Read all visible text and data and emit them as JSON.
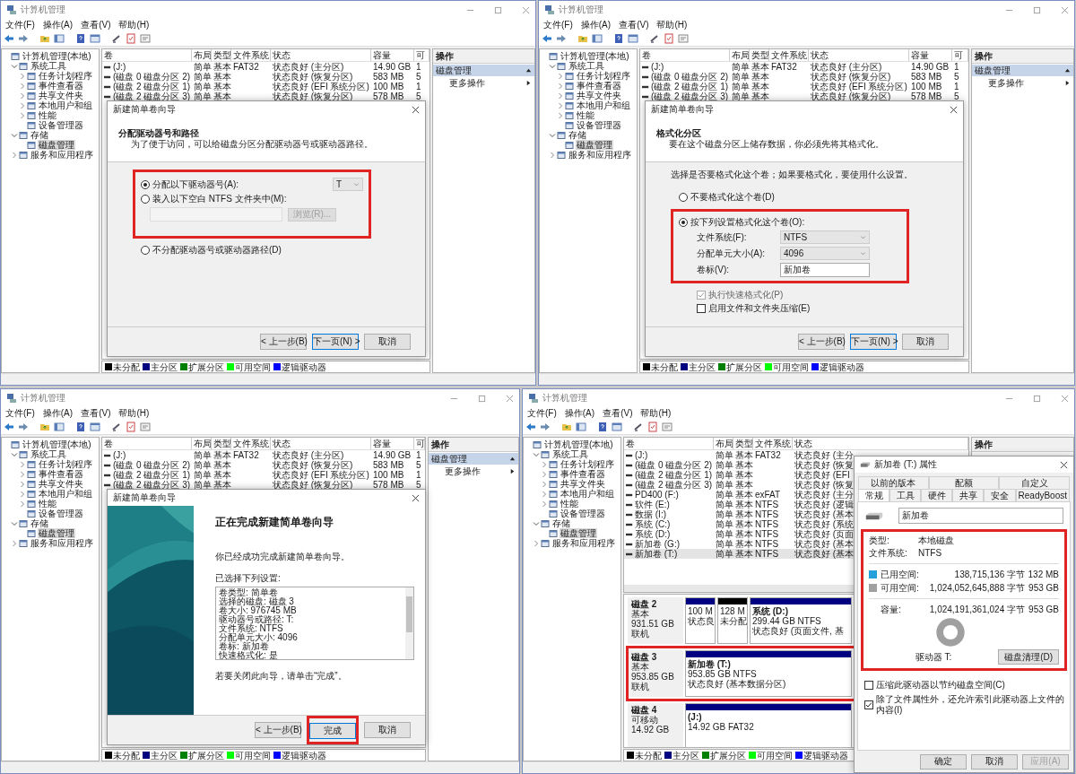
{
  "windows": [
    {
      "title": "计算机管理",
      "menu": [
        "文件(F)",
        "操作(A)",
        "查看(V)",
        "帮助(H)"
      ],
      "tree": [
        {
          "label": "计算机管理(本地)",
          "selected": false,
          "children": [
            {
              "label": "系统工具",
              "selected": false,
              "expanded": true,
              "children": [
                {
                  "label": "任务计划程序",
                  "selected": false,
                  "expanded": false
                },
                {
                  "label": "事件查看器",
                  "selected": false,
                  "expanded": false
                },
                {
                  "label": "共享文件夹",
                  "selected": false,
                  "expanded": false
                },
                {
                  "label": "本地用户和组",
                  "selected": false,
                  "expanded": false
                },
                {
                  "label": "性能",
                  "selected": false,
                  "expanded": false
                },
                {
                  "label": "设备管理器",
                  "selected": false
                }
              ]
            },
            {
              "label": "存储",
              "selected": false,
              "expanded": true,
              "children": [
                {
                  "label": "磁盘管理",
                  "selected": true
                }
              ]
            },
            {
              "label": "服务和应用程序",
              "selected": false,
              "expanded": false
            }
          ]
        }
      ],
      "columns": [
        "卷",
        "布局",
        "类型",
        "文件系统",
        "状态",
        "容量",
        "可"
      ],
      "rows": [
        {
          "volume": "(J:)",
          "layout": "简单",
          "type": "基本",
          "file_system": "FAT32",
          "status": "状态良好 (主分区)",
          "capacity": "14.90 GB",
          "column_7": "1",
          "selected": false
        },
        {
          "volume": "(磁盘 0 磁盘分区 2)",
          "layout": "简单",
          "type": "基本",
          "status": "状态良好 (恢复分区)",
          "capacity": "583 MB",
          "column_7": "5",
          "selected": false
        },
        {
          "volume": "(磁盘 2 磁盘分区 1)",
          "layout": "简单",
          "type": "基本",
          "status": "状态良好 (EFI 系统分区)",
          "capacity": "100 MB",
          "column_7": "1",
          "selected": false
        },
        {
          "volume": "(磁盘 2 磁盘分区 3)",
          "layout": "简单",
          "type": "基本",
          "status": "状态良好 (恢复分区)",
          "capacity": "578 MB",
          "column_7": "5",
          "selected": false
        }
      ],
      "legend": [
        {
          "label": "未分配",
          "color": "#000000"
        },
        {
          "label": "主分区",
          "color": "#000080"
        },
        {
          "label": "扩展分区",
          "color": "#008000"
        },
        {
          "label": "可用空间",
          "color": "#00ff00"
        },
        {
          "label": "逻辑驱动器",
          "color": "#0000ff"
        }
      ],
      "actions": {
        "title": "操作",
        "group": "磁盘管理",
        "items": [
          "更多操作"
        ]
      },
      "dialog": {
        "kind": "wizard",
        "title": "新建简单卷向导",
        "heading": "分配驱动器号和路径",
        "subheading": "为了便于访问，可以给磁盘分区分配驱动器号或驱动器路径。",
        "sections": [
          {
            "highlighted": true,
            "items": [
              {
                "kind": "radio",
                "label": "分配以下驱动器号(A):",
                "selected": true,
                "value": "T"
              },
              {
                "kind": "radio",
                "label": "装入以下空白 NTFS 文件夹中(M):",
                "selected": false
              },
              {
                "kind": "folder_path",
                "button": "浏览(R)...",
                "disabled": true
              }
            ]
          },
          {
            "items": [
              {
                "kind": "radio",
                "label": "不分配驱动器号或驱动器路径(D)",
                "selected": false
              }
            ]
          }
        ],
        "buttons": [
          {
            "label": "< 上一步(B)",
            "default": false
          },
          {
            "label": "下一页(N) >",
            "default": true
          },
          {
            "label": "取消",
            "default": false
          }
        ]
      }
    },
    {
      "title": "计算机管理",
      "menu": [
        "文件(F)",
        "操作(A)",
        "查看(V)",
        "帮助(H)"
      ],
      "tree": [
        {
          "label": "计算机管理(本地)",
          "selected": false,
          "children": [
            {
              "label": "系统工具",
              "selected": false,
              "expanded": true,
              "children": [
                {
                  "label": "任务计划程序",
                  "selected": false,
                  "expanded": false
                },
                {
                  "label": "事件查看器",
                  "selected": false,
                  "expanded": false
                },
                {
                  "label": "共享文件夹",
                  "selected": false,
                  "expanded": false
                },
                {
                  "label": "本地用户和组",
                  "selected": false,
                  "expanded": false
                },
                {
                  "label": "性能",
                  "selected": false,
                  "expanded": false
                },
                {
                  "label": "设备管理器",
                  "selected": false
                }
              ]
            },
            {
              "label": "存储",
              "selected": false,
              "expanded": true,
              "children": [
                {
                  "label": "磁盘管理",
                  "selected": true
                }
              ]
            },
            {
              "label": "服务和应用程序",
              "selected": false,
              "expanded": false
            }
          ]
        }
      ],
      "columns": [
        "卷",
        "布局",
        "类型",
        "文件系统",
        "状态",
        "容量",
        "可"
      ],
      "rows": [
        {
          "volume": "(J:)",
          "layout": "简单",
          "type": "基本",
          "file_system": "FAT32",
          "status": "状态良好 (主分区)",
          "capacity": "14.90 GB",
          "column_7": "1",
          "selected": false
        },
        {
          "volume": "(磁盘 0 磁盘分区 2)",
          "layout": "简单",
          "type": "基本",
          "status": "状态良好 (恢复分区)",
          "capacity": "583 MB",
          "column_7": "5",
          "selected": false
        },
        {
          "volume": "(磁盘 2 磁盘分区 1)",
          "layout": "简单",
          "type": "基本",
          "status": "状态良好 (EFI 系统分区)",
          "capacity": "100 MB",
          "column_7": "1",
          "selected": false
        },
        {
          "volume": "(磁盘 2 磁盘分区 3)",
          "layout": "简单",
          "type": "基本",
          "status": "状态良好 (恢复分区)",
          "capacity": "578 MB",
          "column_7": "5",
          "selected": false
        }
      ],
      "legend": [
        {
          "label": "未分配",
          "color": "#000000"
        },
        {
          "label": "主分区",
          "color": "#000080"
        },
        {
          "label": "扩展分区",
          "color": "#008000"
        },
        {
          "label": "可用空间",
          "color": "#00ff00"
        },
        {
          "label": "逻辑驱动器",
          "color": "#0000ff"
        }
      ],
      "actions": {
        "title": "操作",
        "group": "磁盘管理",
        "items": [
          "更多操作"
        ]
      },
      "dialog": {
        "kind": "wizard",
        "title": "新建简单卷向导",
        "heading": "格式化分区",
        "subheading": "要在这个磁盘分区上储存数据，你必须先将其格式化。",
        "intro": "选择是否要格式化这个卷；如果要格式化，要使用什么设置。",
        "sections": [
          {
            "items": [
              {
                "kind": "radio",
                "label": "不要格式化这个卷(D)",
                "selected": false
              }
            ]
          },
          {
            "highlighted": true,
            "items": [
              {
                "kind": "radio",
                "label": "按下列设置格式化这个卷(O):",
                "selected": true
              },
              {
                "kind": "dropdown",
                "label": "文件系统(F):",
                "value": "NTFS"
              },
              {
                "kind": "dropdown",
                "label": "分配单元大小(A):",
                "value": "4096"
              },
              {
                "kind": "text",
                "label": "卷标(V):",
                "value": "新加卷"
              }
            ]
          },
          {
            "items": [
              {
                "kind": "checkbox",
                "label": "执行快速格式化(P)",
                "checked": true,
                "disabled": true
              },
              {
                "kind": "checkbox",
                "label": "启用文件和文件夹压缩(E)",
                "checked": false,
                "disabled": false
              }
            ]
          }
        ],
        "buttons": [
          {
            "label": "< 上一步(B)",
            "default": false
          },
          {
            "label": "下一页(N) >",
            "default": true
          },
          {
            "label": "取消",
            "default": false
          }
        ]
      }
    },
    {
      "title": "计算机管理",
      "menu": [
        "文件(F)",
        "操作(A)",
        "查看(V)",
        "帮助(H)"
      ],
      "tree": [
        {
          "label": "计算机管理(本地)",
          "selected": false,
          "children": [
            {
              "label": "系统工具",
              "selected": false,
              "expanded": true,
              "children": [
                {
                  "label": "任务计划程序",
                  "selected": false,
                  "expanded": false
                },
                {
                  "label": "事件查看器",
                  "selected": false,
                  "expanded": false
                },
                {
                  "label": "共享文件夹",
                  "selected": false,
                  "expanded": false
                },
                {
                  "label": "本地用户和组",
                  "selected": false,
                  "expanded": false
                },
                {
                  "label": "性能",
                  "selected": false,
                  "expanded": false
                },
                {
                  "label": "设备管理器",
                  "selected": false
                }
              ]
            },
            {
              "label": "存储",
              "selected": false,
              "expanded": true,
              "children": [
                {
                  "label": "磁盘管理",
                  "selected": true
                }
              ]
            },
            {
              "label": "服务和应用程序",
              "selected": false,
              "expanded": false
            }
          ]
        }
      ],
      "columns": [
        "卷",
        "布局",
        "类型",
        "文件系统",
        "状态",
        "容量",
        "可"
      ],
      "rows": [
        {
          "volume": "(J:)",
          "layout": "简单",
          "type": "基本",
          "file_system": "FAT32",
          "status": "状态良好 (主分区)",
          "capacity": "14.90 GB",
          "column_7": "1",
          "selected": false
        },
        {
          "volume": "(磁盘 0 磁盘分区 2)",
          "layout": "简单",
          "type": "基本",
          "status": "状态良好 (恢复分区)",
          "capacity": "583 MB",
          "column_7": "5",
          "selected": false
        },
        {
          "volume": "(磁盘 2 磁盘分区 1)",
          "layout": "简单",
          "type": "基本",
          "status": "状态良好 (EFI 系统分区)",
          "capacity": "100 MB",
          "column_7": "1",
          "selected": false
        },
        {
          "volume": "(磁盘 2 磁盘分区 3)",
          "layout": "简单",
          "type": "基本",
          "status": "状态良好 (恢复分区)",
          "capacity": "578 MB",
          "column_7": "5",
          "selected": false
        }
      ],
      "legend": [
        {
          "label": "未分配",
          "color": "#000000"
        },
        {
          "label": "主分区",
          "color": "#000080"
        },
        {
          "label": "扩展分区",
          "color": "#008000"
        },
        {
          "label": "可用空间",
          "color": "#00ff00"
        },
        {
          "label": "逻辑驱动器",
          "color": "#0000ff"
        }
      ],
      "actions": {
        "title": "操作",
        "group": "磁盘管理",
        "items": [
          "更多操作"
        ]
      },
      "dialog": {
        "kind": "finish",
        "title": "新建简单卷向导",
        "heading": "正在完成新建简单卷向导",
        "message": "你已经成功完成新建简单卷向导。",
        "settings_label": "已选择下列设置:",
        "settings": [
          "卷类型: 简单卷",
          "选择的磁盘: 磁盘 3",
          "卷大小: 976745 MB",
          "驱动器号或路径: T:",
          "文件系统: NTFS",
          "分配单元大小: 4096",
          "卷标: 新加卷",
          "快速格式化: 是"
        ],
        "closing": "若要关闭此向导，请单击“完成”。",
        "buttons": [
          {
            "label": "< 上一步(B)",
            "default": false
          },
          {
            "label": "完成",
            "default": true,
            "highlighted": true
          },
          {
            "label": "取消",
            "default": false
          }
        ]
      }
    },
    {
      "title": "计算机管理",
      "menu": [
        "文件(F)",
        "操作(A)",
        "查看(V)",
        "帮助(H)"
      ],
      "tree": [
        {
          "label": "计算机管理(本地)",
          "selected": false,
          "children": [
            {
              "label": "系统工具",
              "selected": false,
              "expanded": true,
              "children": [
                {
                  "label": "任务计划程序",
                  "selected": false,
                  "expanded": false
                },
                {
                  "label": "事件查看器",
                  "selected": false,
                  "expanded": false
                },
                {
                  "label": "共享文件夹",
                  "selected": false,
                  "expanded": false
                },
                {
                  "label": "本地用户和组",
                  "selected": false,
                  "expanded": false
                },
                {
                  "label": "性能",
                  "selected": false,
                  "expanded": false
                },
                {
                  "label": "设备管理器",
                  "selected": false
                }
              ]
            },
            {
              "label": "存储",
              "selected": false,
              "expanded": true,
              "children": [
                {
                  "label": "磁盘管理",
                  "selected": true
                }
              ]
            },
            {
              "label": "服务和应用程序",
              "selected": false,
              "expanded": false
            }
          ]
        }
      ],
      "columns": [
        "卷",
        "布局",
        "类型",
        "文件系统",
        "状态"
      ],
      "rows": [
        {
          "volume": "(J:)",
          "layout": "简单",
          "type": "基本",
          "file_system": "FAT32",
          "status": "状态良好 (主分",
          "selected": false
        },
        {
          "volume": "(磁盘 0 磁盘分区 2)",
          "layout": "简单",
          "type": "基本",
          "status": "状态良好 (恢复",
          "selected": false
        },
        {
          "volume": "(磁盘 2 磁盘分区 1)",
          "layout": "简单",
          "type": "基本",
          "status": "状态良好 (EFI",
          "selected": false
        },
        {
          "volume": "(磁盘 2 磁盘分区 3)",
          "layout": "简单",
          "type": "基本",
          "status": "状态良好 (恢复",
          "selected": false
        },
        {
          "volume": "PD400 (F:)",
          "layout": "简单",
          "type": "基本",
          "file_system": "exFAT",
          "status": "状态良好 (主分",
          "selected": false
        },
        {
          "volume": "软件 (E:)",
          "layout": "简单",
          "type": "基本",
          "file_system": "NTFS",
          "status": "状态良好 (逻辑",
          "selected": false
        },
        {
          "volume": "数据 (I:)",
          "layout": "简单",
          "type": "基本",
          "file_system": "NTFS",
          "status": "状态良好 (基本",
          "selected": false
        },
        {
          "volume": "系统 (C:)",
          "layout": "简单",
          "type": "基本",
          "file_system": "NTFS",
          "status": "状态良好 (系统,",
          "selected": false
        },
        {
          "volume": "系统 (D:)",
          "layout": "简单",
          "type": "基本",
          "file_system": "NTFS",
          "status": "状态良好 (页面",
          "selected": false
        },
        {
          "volume": "新加卷 (G:)",
          "layout": "简单",
          "type": "基本",
          "file_system": "NTFS",
          "status": "状态良好 (基本",
          "selected": false
        },
        {
          "volume": "新加卷 (T:)",
          "layout": "简单",
          "type": "基本",
          "file_system": "NTFS",
          "status": "状态良好 (基本",
          "selected": true
        }
      ],
      "disks": [
        {
          "name": "磁盘 2",
          "type": "基本",
          "size": "931.51 GB",
          "state": "联机",
          "partitions": [
            {
              "lines": [
                "100 M",
                "状态良"
              ],
              "color": "#000080"
            },
            {
              "lines": [
                "128 M",
                "未分配"
              ],
              "color": "#000000"
            },
            {
              "title": "系统 (D:)",
              "lines": [
                "299.44 GB NTFS",
                "状态良好 (页面文件, 基"
              ],
              "color": "#000080"
            }
          ]
        },
        {
          "name": "磁盘 3",
          "type": "基本",
          "size": "953.85 GB",
          "state": "联机",
          "highlighted": true,
          "partitions": [
            {
              "title": "新加卷 (T:)",
              "lines": [
                "953.85 GB NTFS",
                "状态良好 (基本数据分区)"
              ],
              "color": "#000080"
            }
          ]
        },
        {
          "name": "磁盘 4",
          "type": "可移动",
          "size": "14.92 GB",
          "partitions": [
            {
              "title": "(J:)",
              "lines": [
                "14.92 GB FAT32"
              ],
              "color": "#000080"
            }
          ]
        }
      ],
      "legend": [
        {
          "label": "未分配",
          "color": "#000000"
        },
        {
          "label": "主分区",
          "color": "#000080"
        },
        {
          "label": "扩展分区",
          "color": "#008000"
        },
        {
          "label": "可用空间",
          "color": "#00ff00"
        },
        {
          "label": "逻辑驱动器",
          "color": "#0000ff"
        }
      ],
      "actions": {
        "title": "操作"
      },
      "dialog": {
        "kind": "properties",
        "title": "新加卷 (T:) 属性",
        "tab_rows": [
          [
            {
              "label": "以前的版本",
              "selected": false
            },
            {
              "label": "配额",
              "selected": false
            },
            {
              "label": "自定义",
              "selected": false
            }
          ],
          [
            {
              "label": "常规",
              "selected": true
            },
            {
              "label": "工具",
              "selected": false
            },
            {
              "label": "硬件",
              "selected": false
            },
            {
              "label": "共享",
              "selected": false
            },
            {
              "label": "安全",
              "selected": false
            },
            {
              "label": "ReadyBoost",
              "selected": false
            }
          ]
        ],
        "name": "新加卷",
        "info": {
          "highlighted": true,
          "type_label": "类型:",
          "type": "本地磁盘",
          "fs_label": "文件系统:",
          "fs": "NTFS",
          "space": [
            {
              "label": "已用空间:",
              "bytes": "138,715,136 字节",
              "size": "132 MB",
              "color": "#26a0da"
            },
            {
              "label": "可用空间:",
              "bytes": "1,024,052,645,888 字节",
              "size": "953 GB",
              "color": "#a0a0a0"
            }
          ],
          "capacity_label": "容量:",
          "capacity_bytes": "1,024,191,361,024 字节",
          "capacity_size": "953 GB",
          "drive": "驱动器 T:",
          "cleanup_button": "磁盘清理(D)"
        },
        "options": [
          {
            "label": "压缩此驱动器以节约磁盘空间(C)",
            "checked": false
          },
          {
            "label": "除了文件属性外，还允许索引此驱动器上文件的内容(I)",
            "checked": true
          }
        ],
        "buttons": [
          {
            "label": "确定",
            "disabled": false
          },
          {
            "label": "取消",
            "disabled": false
          },
          {
            "label": "应用(A)",
            "disabled": true
          }
        ]
      }
    }
  ]
}
